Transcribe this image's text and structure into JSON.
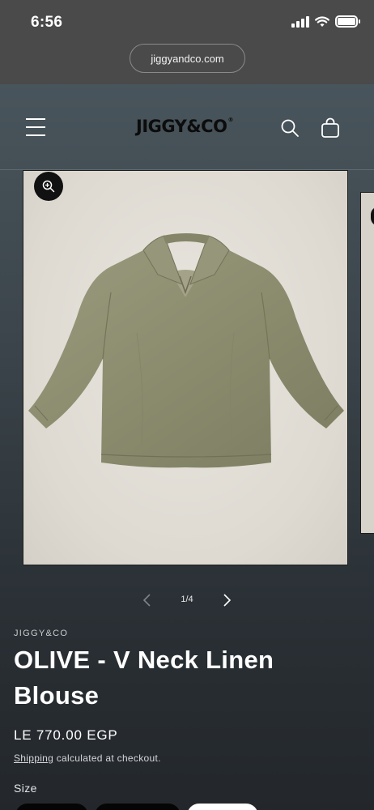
{
  "status_bar": {
    "time": "6:56"
  },
  "browser": {
    "url": "jiggyandco.com"
  },
  "header": {
    "logo_text": "JIGGY&CO",
    "logo_mark": "®"
  },
  "gallery": {
    "counter": "1/4",
    "image_alt": "Olive V neck linen blouse"
  },
  "product": {
    "vendor": "JIGGY&CO",
    "title": "OLIVE - V Neck Linen Blouse",
    "price": "LE 770.00 EGP",
    "shipping_link": "Shipping",
    "shipping_note": " calculated at checkout."
  },
  "options": {
    "size_label": "Size"
  },
  "colors": {
    "image_bg": "#e2ded6",
    "blouse": "#8b8b6e",
    "text": "#ffffff"
  }
}
